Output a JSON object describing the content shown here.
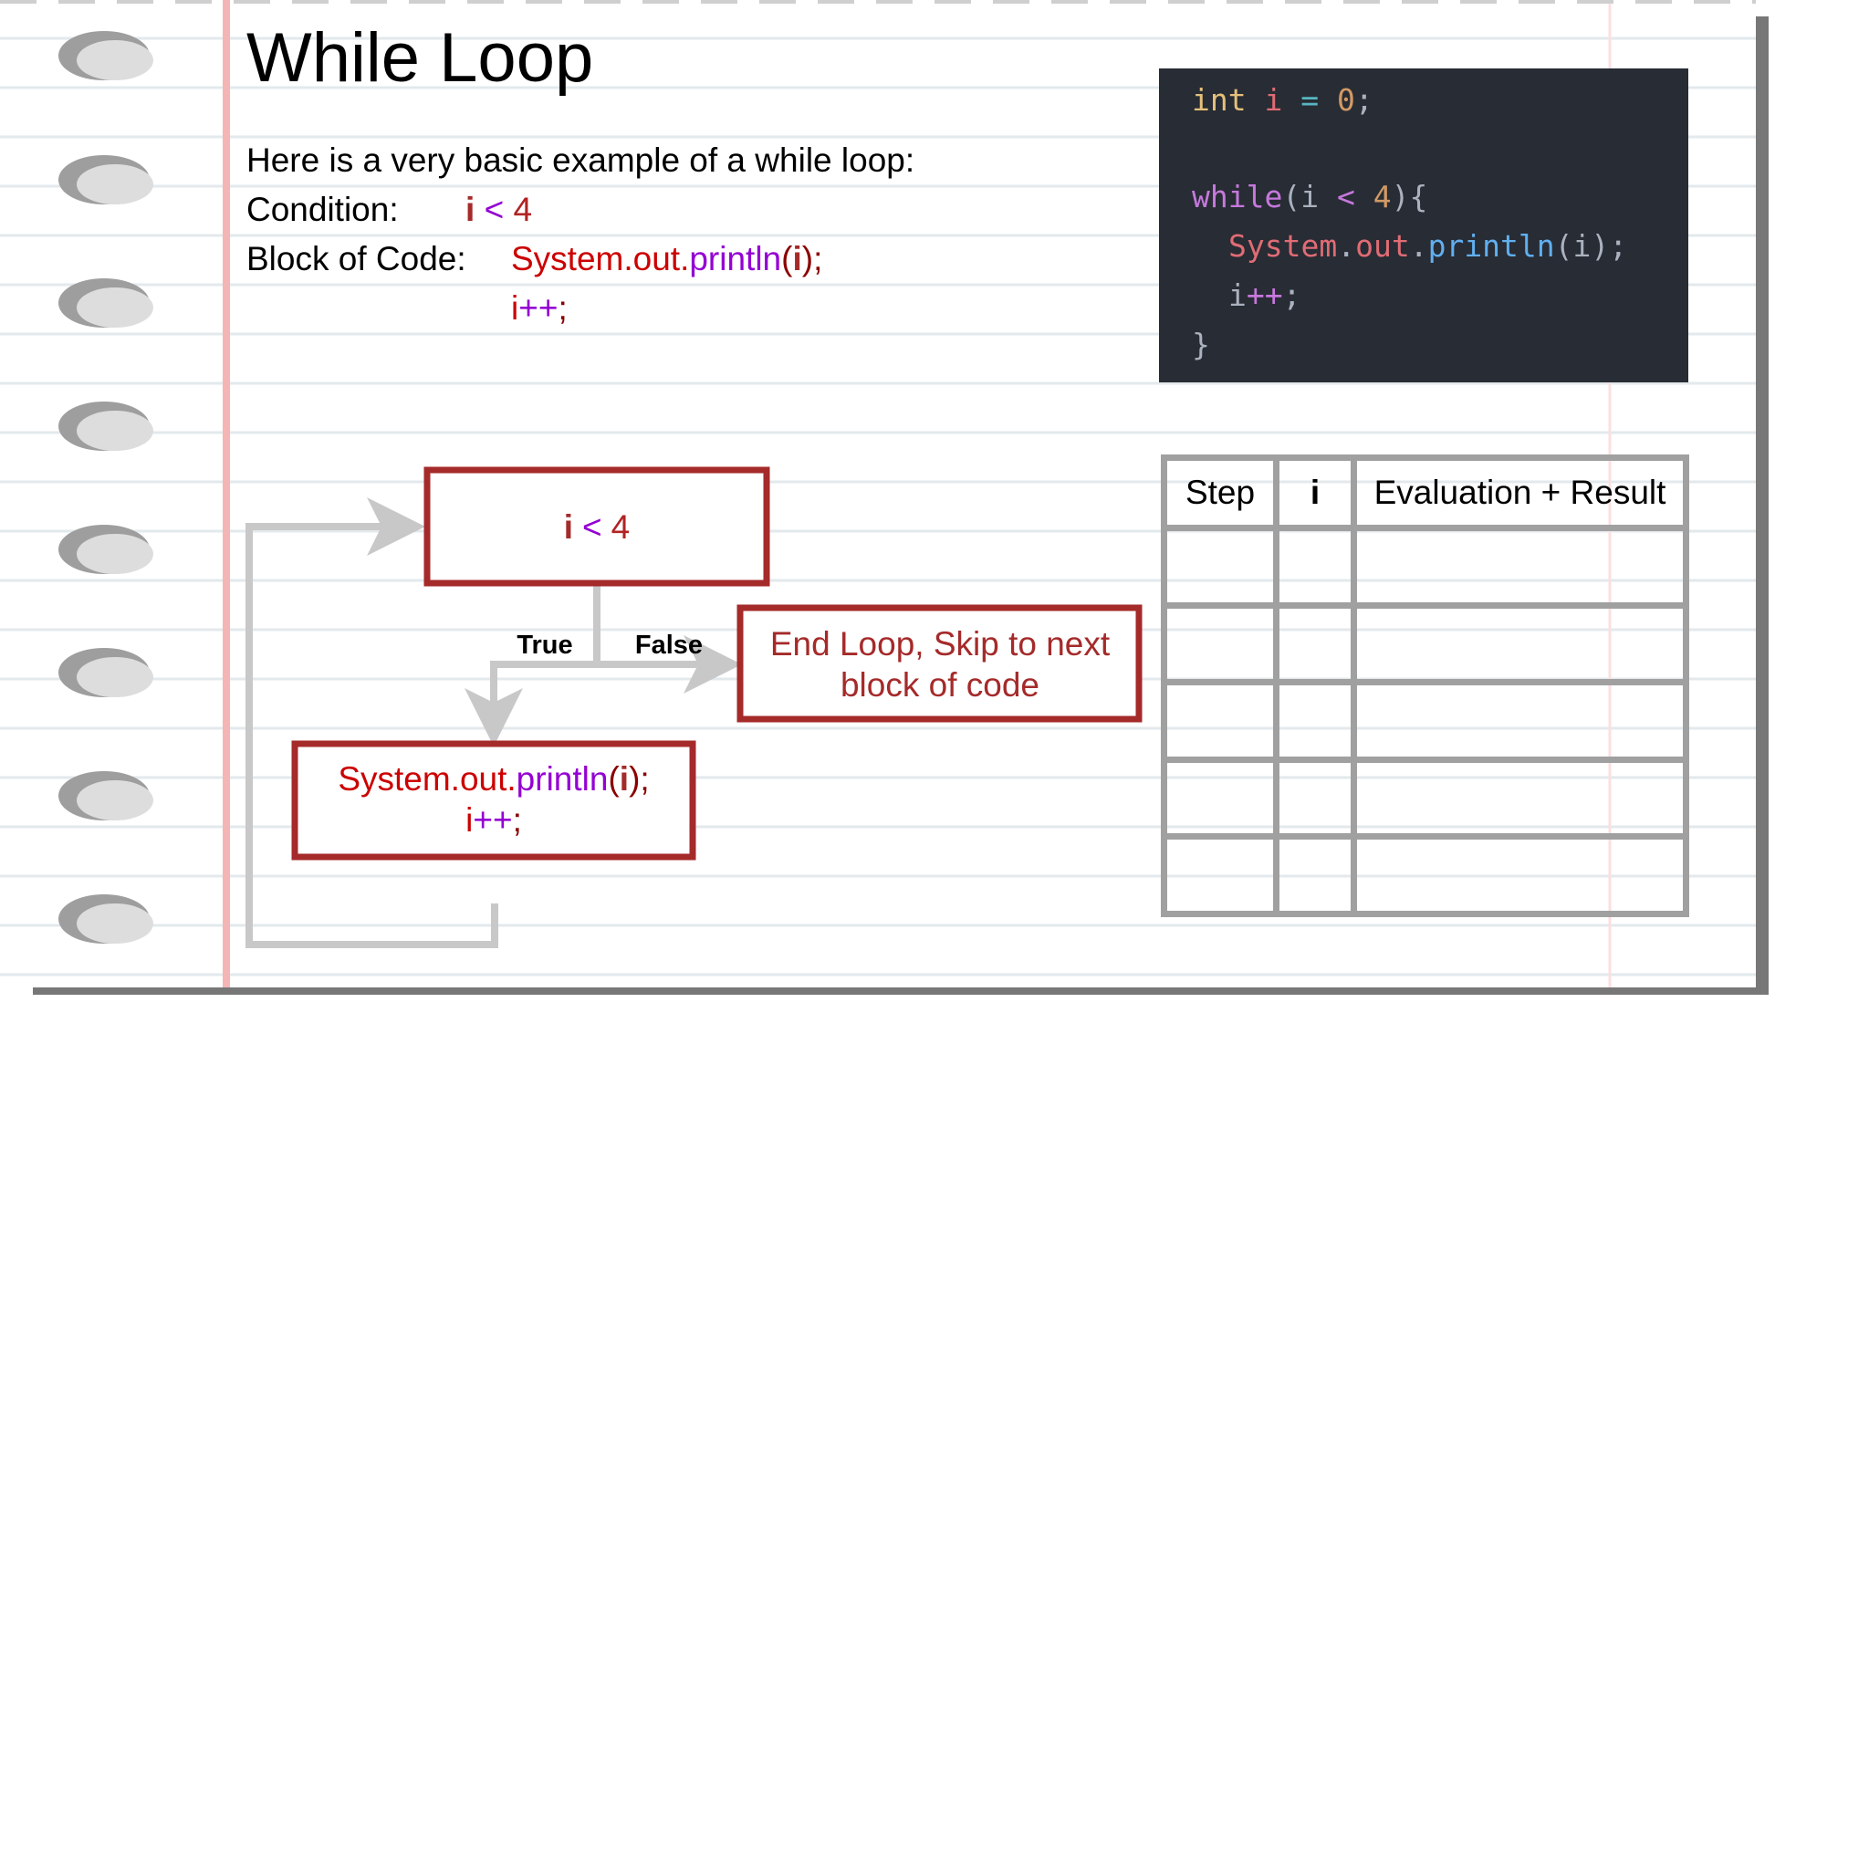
{
  "title": "While Loop",
  "intro": "Here is a very basic example of a while loop:",
  "condition_row": {
    "label": "Condition:",
    "var": "i",
    "op": "<",
    "num": "4"
  },
  "block_row": {
    "label": "Block of Code:",
    "class_path": "System.out.",
    "method": "println",
    "paren_open": "(",
    "arg": "i",
    "paren_close": ");",
    "inc_var": "i",
    "inc_op": "++",
    "semicolon": ";"
  },
  "code": {
    "line1": {
      "type": "int",
      "var": "i",
      "op": "=",
      "num": "0",
      "end": ";"
    },
    "line2": {
      "keyword": "while",
      "open": "(i",
      "op": "<",
      "num": "4",
      "close": "){"
    },
    "line3": {
      "cls": "System",
      "dot1": ".",
      "field": "out",
      "dot2": ".",
      "method": "println",
      "args": "(i);"
    },
    "line4": {
      "var": "i",
      "op": "++",
      "end": ";"
    },
    "line5": "}"
  },
  "flowchart": {
    "condition": {
      "var": "i",
      "op": "<",
      "num": "4"
    },
    "true_label": "True",
    "false_label": "False",
    "end_line1": "End Loop, Skip to next",
    "end_line2": "block of code",
    "body": {
      "class_path": "System.out.",
      "method": "println",
      "paren_open": "(",
      "arg": "i",
      "paren_close": ");",
      "inc_var": "i",
      "inc_op": "++",
      "semicolon": ";"
    }
  },
  "trace_table": {
    "headers": [
      "Step",
      "i",
      "Evaluation + Result"
    ],
    "rows": [
      [
        "",
        "",
        ""
      ],
      [
        "",
        "",
        ""
      ],
      [
        "",
        "",
        ""
      ],
      [
        "",
        "",
        ""
      ],
      [
        "",
        "",
        ""
      ]
    ]
  },
  "colors": {
    "box_border": "#a52a2a",
    "arrow": "#c8c8c8",
    "code_bg": "#282c34",
    "paper_line": "#dfe6ea",
    "margin_line": "#f5b5b5"
  }
}
